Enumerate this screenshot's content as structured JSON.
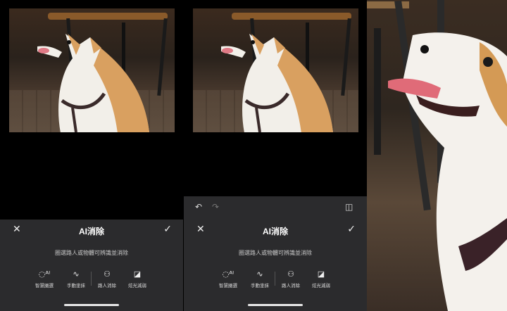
{
  "panels": [
    {
      "sheet": {
        "close_icon": "close-icon",
        "title": "AI消除",
        "confirm_icon": "check-icon",
        "hint": "圈選路人或物體可辨識並消除",
        "tools": [
          {
            "icon": "ai-select-icon",
            "label": "智慧圈選"
          },
          {
            "icon": "brush-icon",
            "label": "手動塗抹"
          },
          {
            "icon": "people-icon",
            "label": "路人消除"
          },
          {
            "icon": "glare-icon",
            "label": "炫光減弱"
          }
        ]
      }
    },
    {
      "toolbar": {
        "undo_icon": "undo-icon",
        "redo_icon": "redo-icon",
        "compare_icon": "compare-icon"
      },
      "sheet": {
        "close_icon": "close-icon",
        "title": "AI消除",
        "confirm_icon": "check-icon",
        "hint": "圈選路人或物體可辨識並消除",
        "tools": [
          {
            "icon": "ai-select-icon",
            "label": "智慧圈選"
          },
          {
            "icon": "brush-icon",
            "label": "手動塗抹"
          },
          {
            "icon": "people-icon",
            "label": "路人消除"
          },
          {
            "icon": "glare-icon",
            "label": "炫光減弱"
          }
        ]
      }
    }
  ]
}
